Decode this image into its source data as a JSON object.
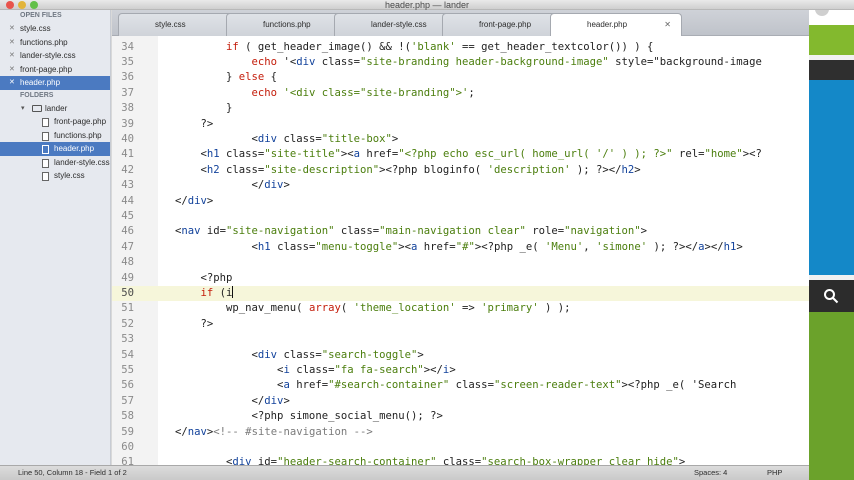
{
  "window": {
    "title": "header.php — lander"
  },
  "colors": {
    "selection": "#4b7ac1",
    "string": "#4b7e0d",
    "keyword": "#c41d0b",
    "tag": "#12429b",
    "current_line": "#f6f6da"
  },
  "sidebar": {
    "open_files_header": "OPEN FILES",
    "open_files": [
      {
        "label": "style.css",
        "selected": false
      },
      {
        "label": "functions.php",
        "selected": false
      },
      {
        "label": "lander-style.css",
        "selected": false
      },
      {
        "label": "front-page.php",
        "selected": false
      },
      {
        "label": "header.php",
        "selected": true
      }
    ],
    "folders_header": "FOLDERS",
    "folder": {
      "label": "lander",
      "expanded": true
    },
    "folder_files": [
      {
        "label": "front-page.php",
        "selected": false
      },
      {
        "label": "functions.php",
        "selected": false
      },
      {
        "label": "header.php",
        "selected": true
      },
      {
        "label": "lander-style.css",
        "selected": false
      },
      {
        "label": "style.css",
        "selected": false
      }
    ]
  },
  "tabs": [
    {
      "label": "style.css",
      "active": false,
      "modified": false
    },
    {
      "label": "functions.php",
      "active": false,
      "modified": false
    },
    {
      "label": "lander-style.css",
      "active": false,
      "modified": false
    },
    {
      "label": "front-page.php",
      "active": false,
      "modified": true
    },
    {
      "label": "header.php",
      "active": true,
      "modified": false
    }
  ],
  "editor": {
    "current_line": 50,
    "lines": [
      {
        "n": "34",
        "code": "        if ( get_header_image() && !('blank' == get_header_textcolor()) ) {"
      },
      {
        "n": "35",
        "code": "            echo '<div class=\"site-branding header-background-image\" style=\"background-image"
      },
      {
        "n": "36",
        "code": "        } else {"
      },
      {
        "n": "37",
        "code": "            echo '<div class=\"site-branding\">';"
      },
      {
        "n": "38",
        "code": "        }"
      },
      {
        "n": "39",
        "code": "    ?>"
      },
      {
        "n": "40",
        "code": "            <div class=\"title-box\">"
      },
      {
        "n": "41",
        "code": "    <h1 class=\"site-title\"><a href=\"<?php echo esc_url( home_url( '/' ) ); ?>\" rel=\"home\"><?"
      },
      {
        "n": "42",
        "code": "    <h2 class=\"site-description\"><?php bloginfo( 'description' ); ?></h2>"
      },
      {
        "n": "43",
        "code": "            </div>"
      },
      {
        "n": "44",
        "code": "</div>"
      },
      {
        "n": "45",
        "code": ""
      },
      {
        "n": "46",
        "code": "<nav id=\"site-navigation\" class=\"main-navigation clear\" role=\"navigation\">"
      },
      {
        "n": "47",
        "code": "            <h1 class=\"menu-toggle\"><a href=\"#\"><?php _e( 'Menu', 'simone' ); ?></a></h1>"
      },
      {
        "n": "48",
        "code": ""
      },
      {
        "n": "49",
        "code": "    <?php"
      },
      {
        "n": "50",
        "code": "    if (i"
      },
      {
        "n": "51",
        "code": "        wp_nav_menu( array( 'theme_location' => 'primary' ) );"
      },
      {
        "n": "52",
        "code": "    ?>"
      },
      {
        "n": "53",
        "code": ""
      },
      {
        "n": "54",
        "code": "            <div class=\"search-toggle\">"
      },
      {
        "n": "55",
        "code": "                <i class=\"fa fa-search\"></i>"
      },
      {
        "n": "56",
        "code": "                <a href=\"#search-container\" class=\"screen-reader-text\"><?php _e( 'Search"
      },
      {
        "n": "57",
        "code": "            </div>"
      },
      {
        "n": "58",
        "code": "            <?php simone_social_menu(); ?>"
      },
      {
        "n": "59",
        "code": "</nav><!-- #site-navigation -->"
      },
      {
        "n": "60",
        "code": ""
      },
      {
        "n": "61",
        "code": "        <div id=\"header-search-container\" class=\"search-box-wrapper clear hide\">"
      }
    ]
  },
  "status": {
    "position": "Line 50, Column 18 - Field 1 of 2",
    "indent": "Spaces: 4",
    "syntax": "PHP"
  },
  "background_window": {
    "left_letter": "H"
  }
}
